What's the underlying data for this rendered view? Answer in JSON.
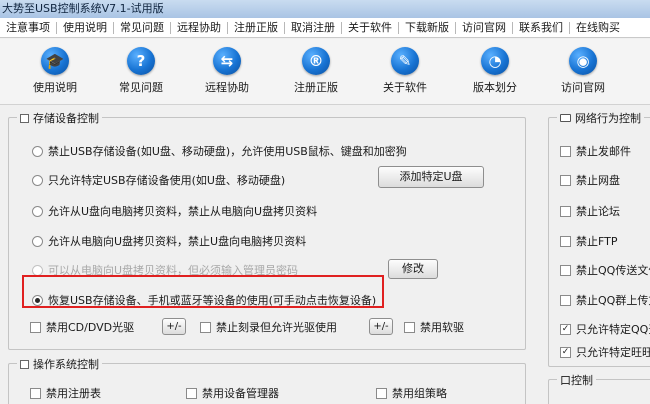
{
  "window": {
    "title": "大势至USB控制系统V7.1-试用版"
  },
  "menu": [
    "注意事项",
    "使用说明",
    "常见问题",
    "远程协助",
    "注册正版",
    "取消注册",
    "关于软件",
    "下载新版",
    "访问官网",
    "联系我们",
    "在线购买"
  ],
  "toolbar": [
    {
      "label": "使用说明",
      "icon": "graduation-cap-icon",
      "glyph": "🎓"
    },
    {
      "label": "常见问题",
      "icon": "question-icon",
      "glyph": "?"
    },
    {
      "label": "远程协助",
      "icon": "remote-assist-icon",
      "glyph": "⇆"
    },
    {
      "label": "注册正版",
      "icon": "registered-icon",
      "glyph": "®"
    },
    {
      "label": "关于软件",
      "icon": "info-icon",
      "glyph": "✎"
    },
    {
      "label": "版本划分",
      "icon": "version-pie-icon",
      "glyph": "◔"
    },
    {
      "label": "访问官网",
      "icon": "globe-icon",
      "glyph": "◉"
    }
  ],
  "storage": {
    "title": "存储设备控制",
    "options": [
      "禁止USB存储设备(如U盘、移动硬盘)，允许使用USB鼠标、键盘和加密狗",
      "只允许特定USB存储设备使用(如U盘、移动硬盘)",
      "允许从U盘向电脑拷贝资料，禁止从电脑向U盘拷贝资料",
      "允许从电脑向U盘拷贝资料，禁止U盘向电脑拷贝资料",
      "可以从电脑向U盘拷贝资料，但必须输入管理员密码",
      "恢复USB存储设备、手机或蓝牙等设备的使用(可手动点击恢复设备)"
    ],
    "selected_index": 5,
    "add_button": "添加特定U盘",
    "modify_button": "修改",
    "cd_label": "禁用CD/DVD光驱",
    "burn_label": "禁止刻录但允许光驱使用",
    "floppy_label": "禁用软驱",
    "toggle_button": "+/-"
  },
  "os": {
    "title": "操作系统控制",
    "items": [
      "禁用注册表",
      "禁用设备管理器",
      "禁用组策略"
    ]
  },
  "network": {
    "title": "网络行为控制",
    "items": [
      "禁止发邮件",
      "禁止网盘",
      "禁止论坛",
      "禁止FTP",
      "禁止QQ传送文件",
      "禁止QQ群上传文",
      "只允许特定QQ登",
      "只允许特定旺旺"
    ],
    "checked": [
      false,
      false,
      false,
      false,
      false,
      false,
      true,
      true
    ],
    "partial_title": "口控制"
  }
}
